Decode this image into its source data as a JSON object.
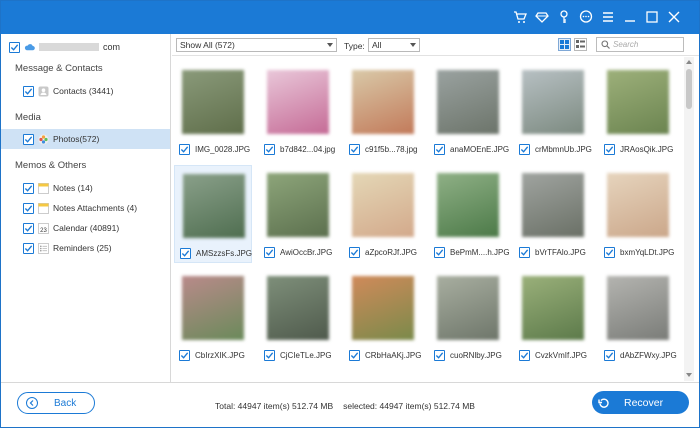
{
  "account": {
    "suffix": "com"
  },
  "sidebar": {
    "sections": [
      {
        "label": "Message & Contacts"
      },
      {
        "label": "Media"
      },
      {
        "label": "Memos & Others"
      }
    ],
    "items": [
      {
        "label": "Contacts (3441)",
        "icon": "contacts-icon"
      },
      {
        "label": "Photos(572)",
        "icon": "photos-icon",
        "selected": true
      },
      {
        "label": "Notes (14)",
        "icon": "notes-icon"
      },
      {
        "label": "Notes Attachments (4)",
        "icon": "notes-attachments-icon"
      },
      {
        "label": "Calendar (40891)",
        "icon": "calendar-icon",
        "badge": "23"
      },
      {
        "label": "Reminders (25)",
        "icon": "reminders-icon"
      }
    ]
  },
  "toolbar": {
    "show_value": "Show All (572)",
    "type_label": "Type:",
    "type_value": "All",
    "search_placeholder": "Search"
  },
  "photos": [
    {
      "name": "IMG_0028.JPG",
      "colors": [
        "#8a9a7a",
        "#5f6e4a"
      ]
    },
    {
      "name": "b7d842...04.jpg",
      "colors": [
        "#e9c7d9",
        "#c56b96"
      ]
    },
    {
      "name": "c91f5b...78.jpg",
      "colors": [
        "#d9c9a8",
        "#c27a5a"
      ]
    },
    {
      "name": "anaMOEnE.JPG",
      "colors": [
        "#9aa2a0",
        "#6c746a"
      ]
    },
    {
      "name": "crMbmnUb.JPG",
      "colors": [
        "#b7c0c3",
        "#7c8a80"
      ]
    },
    {
      "name": "JRAosQik.JPG",
      "colors": [
        "#9db07a",
        "#6b8450"
      ]
    },
    {
      "name": "AMSzzsFs.JPG",
      "colors": [
        "#8aa08a",
        "#4f6e50"
      ],
      "selected": true
    },
    {
      "name": "AwiOccBr.JPG",
      "colors": [
        "#8da57a",
        "#5c704e"
      ]
    },
    {
      "name": "aZpcoRJf.JPG",
      "colors": [
        "#e4d7b6",
        "#d3a98b"
      ]
    },
    {
      "name": "BePmM....h.JPG",
      "colors": [
        "#8fb086",
        "#4c7a48"
      ]
    },
    {
      "name": "bVrTFAlo.JPG",
      "colors": [
        "#a0a4a0",
        "#6a7066"
      ]
    },
    {
      "name": "bxmYqLDt.JPG",
      "colors": [
        "#e6d4bd",
        "#cba78a"
      ]
    },
    {
      "name": "CbIrzXIK.JPG",
      "colors": [
        "#b98a8a",
        "#6a8a5a"
      ]
    },
    {
      "name": "CjCIeTLe.JPG",
      "colors": [
        "#7e8f7a",
        "#4f5a4c"
      ]
    },
    {
      "name": "CRbHaAKj.JPG",
      "colors": [
        "#d08a5a",
        "#7a8a4a"
      ]
    },
    {
      "name": "cuoRNlby.JPG",
      "colors": [
        "#a8aea0",
        "#6e766a"
      ]
    },
    {
      "name": "CvzkVmIf.JPG",
      "colors": [
        "#9ab07a",
        "#5c7a4a"
      ]
    },
    {
      "name": "dAbZFWxy.JPG",
      "colors": [
        "#b4b4b0",
        "#7a7c78"
      ]
    }
  ],
  "footer": {
    "back_label": "Back",
    "total": "Total: 44947 item(s) 512.74 MB",
    "selected": "selected: 44947 item(s) 512.74 MB",
    "recover_label": "Recover"
  },
  "colors": {
    "accent": "#1b7ad6",
    "selected_bg": "#cfe2f5"
  }
}
